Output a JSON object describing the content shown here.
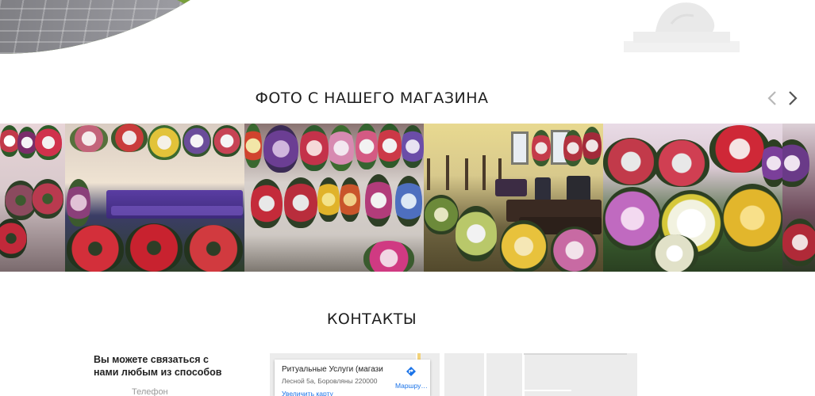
{
  "hero": {
    "photo_icon": "park-path-photo",
    "monument_icon": "monument-sculpture-icon"
  },
  "photos_section": {
    "title": "ФОТО С НАШЕГО МАГАЗИНА",
    "prev_icon": "chevron-left-icon",
    "next_icon": "chevron-right-icon",
    "photos": [
      {
        "name": "shop-photo-wreaths-wall"
      },
      {
        "name": "shop-photo-coffin-purple"
      },
      {
        "name": "shop-photo-wreaths-display"
      },
      {
        "name": "shop-photo-hall-crosses"
      },
      {
        "name": "shop-photo-flower-baskets"
      },
      {
        "name": "shop-photo-partial"
      }
    ]
  },
  "contacts_section": {
    "title": "КОНТАКТЫ",
    "intro": "Вы можете связаться с нами любым из способов",
    "phone_label": "Телефон"
  },
  "map": {
    "place_name": "Ритуальные Услуги (магази…",
    "address": "Лесной 5а, Боровляны 220000",
    "link_text": "Увеличить карту",
    "route_label": "Маршру…",
    "route_icon": "directions-icon",
    "colors": {
      "link": "#1a73e8",
      "background": "#ececec"
    }
  }
}
